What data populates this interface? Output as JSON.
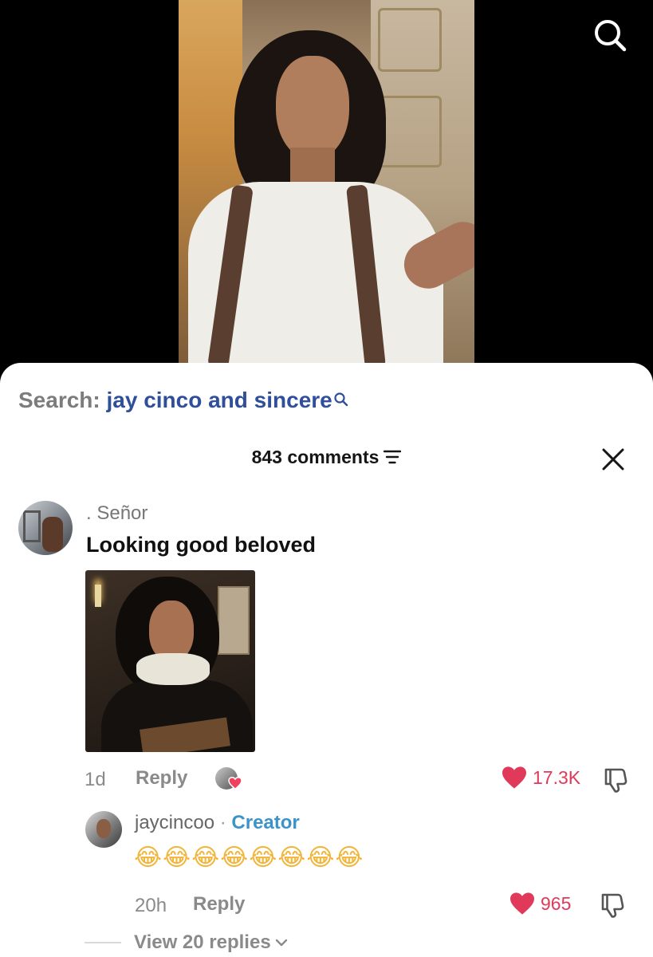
{
  "video": {
    "background_color": "#000000"
  },
  "search_bar": {
    "prefix": "Search:",
    "query": "jay cinco and sincere",
    "icon": "search-icon",
    "query_color": "#2f4f9b"
  },
  "comments_header": {
    "count_label": "843 comments",
    "filter_icon": "filter-icon",
    "close_icon": "close-icon"
  },
  "comment": {
    "username": ". Señor",
    "text": "Looking good beloved",
    "image": "portrait-image",
    "age": "1d",
    "reply_label": "Reply",
    "likes": "17.3K",
    "like_color": "#e1395a"
  },
  "reply": {
    "username": "jaycincoo",
    "separator": "·",
    "badge": "Creator",
    "badge_color": "#3a94c9",
    "emojis": "😂😂😂😂😂😂😂😂",
    "age": "20h",
    "reply_label": "Reply",
    "likes": "965"
  },
  "view_replies": {
    "label": "View 20 replies"
  }
}
